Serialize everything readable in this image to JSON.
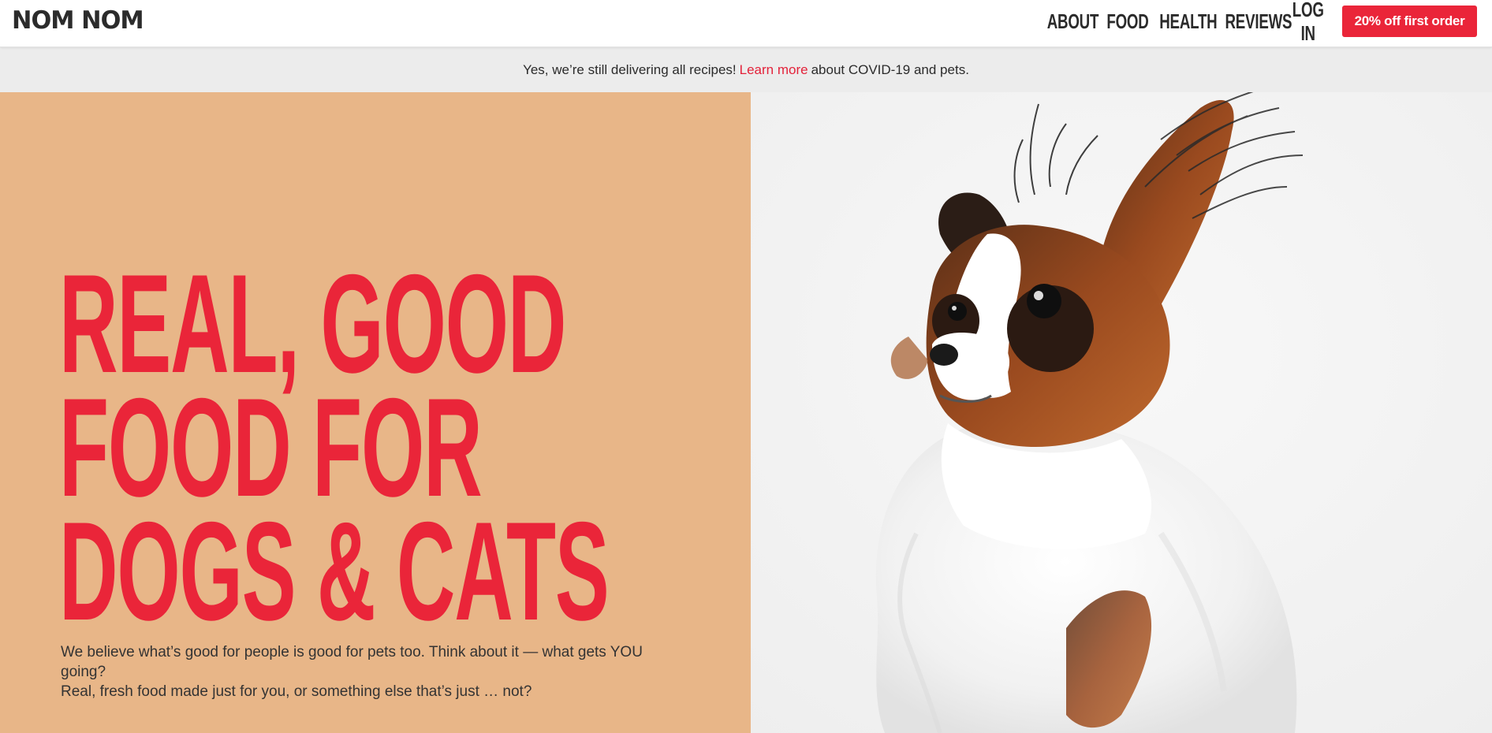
{
  "header": {
    "logo": "NOM NOM",
    "nav": [
      {
        "label": "ABOUT"
      },
      {
        "label": "FOOD"
      },
      {
        "label": "HEALTH"
      },
      {
        "label": "REVIEWS"
      },
      {
        "label": "LOG IN"
      }
    ],
    "cta_label": "20% off first order"
  },
  "banner": {
    "prefix": "Yes, we’re still delivering all recipes!",
    "link_label": "Learn more",
    "suffix": "about COVID-19 and pets."
  },
  "hero": {
    "headline_lines": [
      "REAL, GOOD",
      "FOOD FOR",
      "DOGS & CATS"
    ],
    "subtext_line1": "We believe what’s good for people is good for pets too. Think about it — what gets YOU going?",
    "subtext_line2": "Real, fresh food made just for you, or something else that’s just … not?",
    "image_subject": "papillon-dog-photo"
  },
  "colors": {
    "brand_red": "#ea2539",
    "hero_tan": "#e8b688",
    "banner_gray": "#ececec",
    "text_dark": "#2b2b2b"
  }
}
